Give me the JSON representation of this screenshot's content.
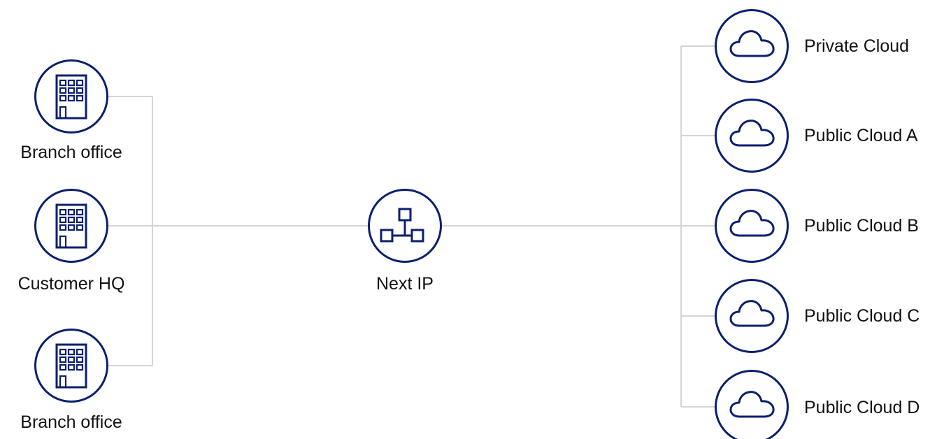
{
  "colors": {
    "node": "#0b1f6f",
    "line": "#d2d5da",
    "text": "#111111"
  },
  "sites": [
    {
      "label": "Branch office",
      "icon": "building-icon"
    },
    {
      "label": "Customer HQ",
      "icon": "building-icon"
    },
    {
      "label": "Branch office",
      "icon": "building-icon"
    }
  ],
  "hub": {
    "label": "Next IP",
    "icon": "network-icon"
  },
  "clouds": [
    {
      "label": "Private Cloud",
      "icon": "cloud-icon"
    },
    {
      "label": "Public Cloud A",
      "icon": "cloud-icon"
    },
    {
      "label": "Public Cloud B",
      "icon": "cloud-icon"
    },
    {
      "label": "Public Cloud C",
      "icon": "cloud-icon"
    },
    {
      "label": "Public Cloud D",
      "icon": "cloud-icon"
    }
  ]
}
